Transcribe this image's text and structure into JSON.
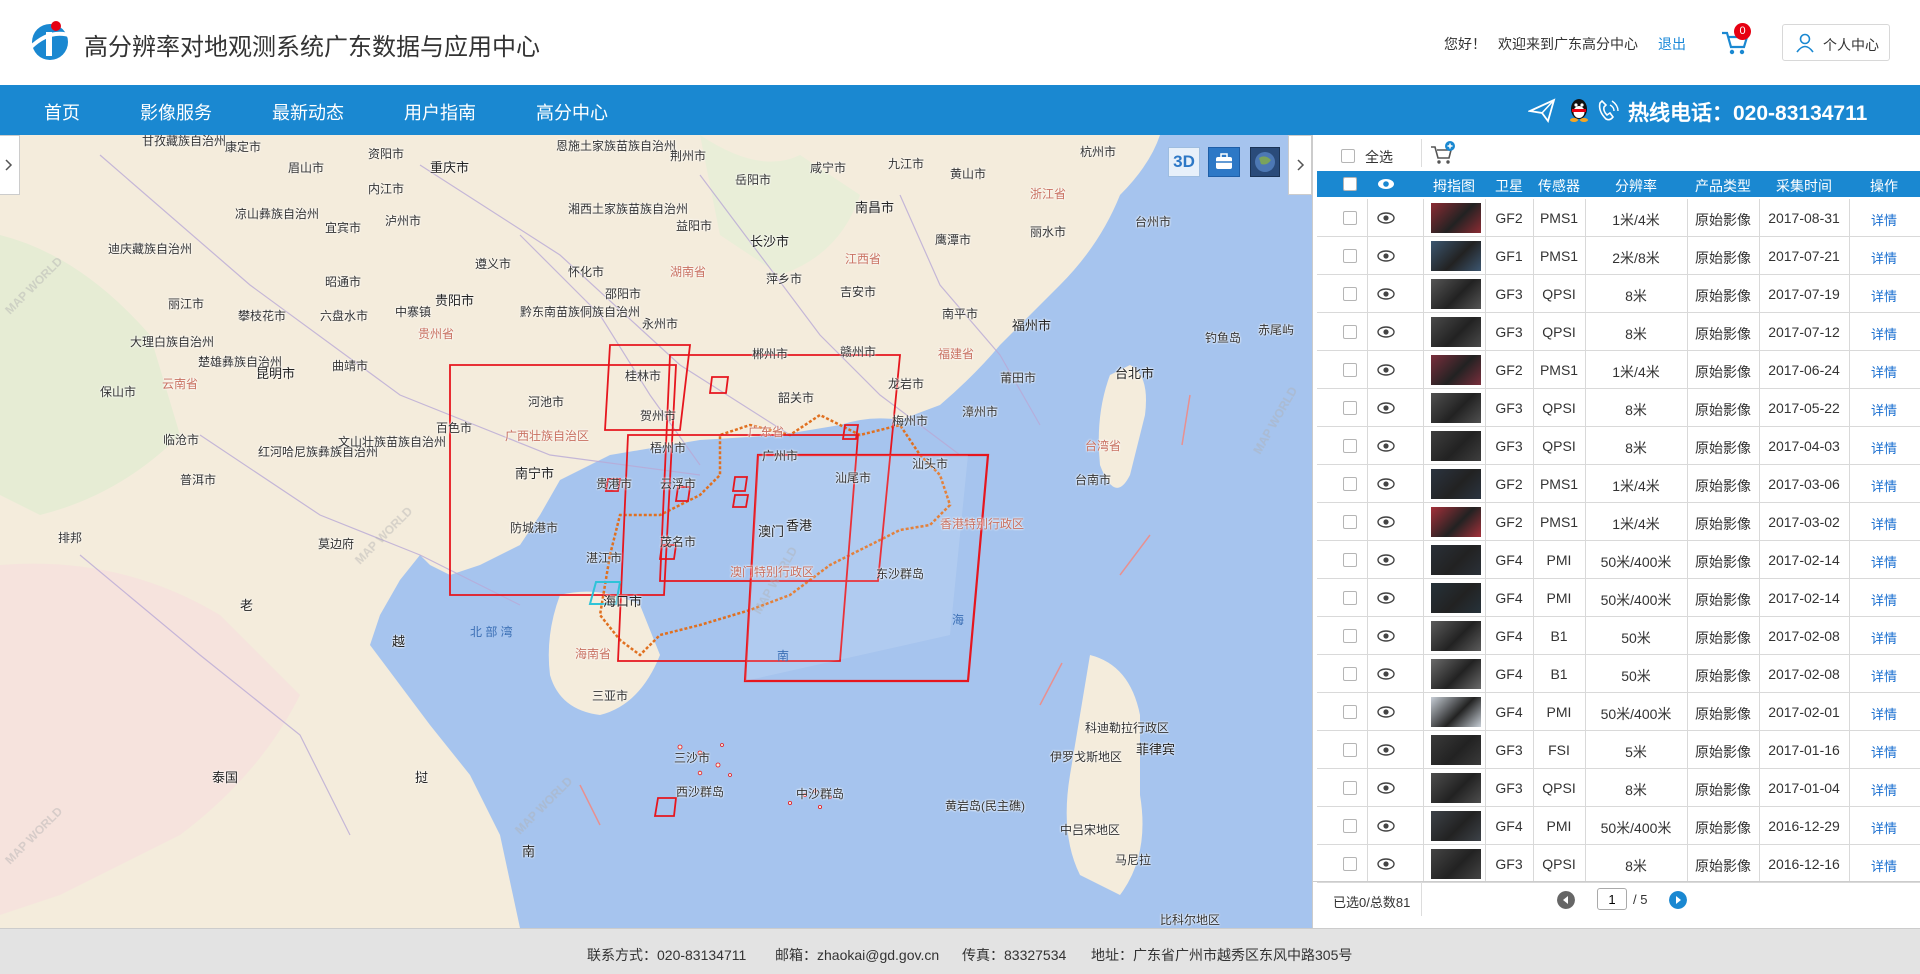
{
  "header": {
    "site_title": "高分辨率对地观测系统广东数据与应用中心",
    "greeting": "您好！",
    "welcome": "欢迎来到广东高分中心",
    "logout": "退出",
    "cart_count": "0",
    "user_center": "个人中心"
  },
  "nav": {
    "items": [
      "首页",
      "影像服务",
      "最新动态",
      "用户指南",
      "高分中心"
    ],
    "hotline": "热线电话：020-83134711"
  },
  "map": {
    "tool_3d": "3D",
    "labels": [
      {
        "t": "甘孜藏族自治州",
        "cls": ""
      },
      {
        "t": "康定市",
        "cls": ""
      },
      {
        "t": "眉山市",
        "cls": ""
      },
      {
        "t": "资阳市",
        "cls": ""
      },
      {
        "t": "重庆市",
        "cls": "big"
      },
      {
        "t": "恩施土家族苗族自治州",
        "cls": ""
      },
      {
        "t": "荆州市",
        "cls": ""
      },
      {
        "t": "咸宁市",
        "cls": ""
      },
      {
        "t": "九江市",
        "cls": ""
      },
      {
        "t": "黄山市",
        "cls": ""
      },
      {
        "t": "杭州市",
        "cls": ""
      },
      {
        "t": "内江市",
        "cls": ""
      },
      {
        "t": "岳阳市",
        "cls": ""
      },
      {
        "t": "南昌市",
        "cls": "big"
      },
      {
        "t": "浙江省",
        "cls": "prov"
      },
      {
        "t": "凉山彝族自治州",
        "cls": ""
      },
      {
        "t": "宜宾市",
        "cls": ""
      },
      {
        "t": "泸州市",
        "cls": ""
      },
      {
        "t": "湘西土家族苗族自治州",
        "cls": ""
      },
      {
        "t": "益阳市",
        "cls": ""
      },
      {
        "t": "长沙市",
        "cls": "big"
      },
      {
        "t": "鹰潭市",
        "cls": ""
      },
      {
        "t": "丽水市",
        "cls": ""
      },
      {
        "t": "台州市",
        "cls": ""
      },
      {
        "t": "迪庆藏族自治州",
        "cls": ""
      },
      {
        "t": "遵义市",
        "cls": ""
      },
      {
        "t": "怀化市",
        "cls": ""
      },
      {
        "t": "萍乡市",
        "cls": ""
      },
      {
        "t": "湖南省",
        "cls": "prov"
      },
      {
        "t": "江西省",
        "cls": "prov"
      },
      {
        "t": "昭通市",
        "cls": ""
      },
      {
        "t": "贵阳市",
        "cls": "big"
      },
      {
        "t": "邵阳市",
        "cls": ""
      },
      {
        "t": "吉安市",
        "cls": ""
      },
      {
        "t": "丽江市",
        "cls": ""
      },
      {
        "t": "攀枝花市",
        "cls": ""
      },
      {
        "t": "六盘水市",
        "cls": ""
      },
      {
        "t": "中寨镇",
        "cls": ""
      },
      {
        "t": "黔东南苗族侗族自治州",
        "cls": ""
      },
      {
        "t": "永州市",
        "cls": ""
      },
      {
        "t": "南平市",
        "cls": ""
      },
      {
        "t": "福州市",
        "cls": "big"
      },
      {
        "t": "钓鱼岛",
        "cls": ""
      },
      {
        "t": "赤尾屿",
        "cls": ""
      },
      {
        "t": "大理白族自治州",
        "cls": ""
      },
      {
        "t": "楚雄彝族自治州",
        "cls": ""
      },
      {
        "t": "昆明市",
        "cls": "big"
      },
      {
        "t": "曲靖市",
        "cls": ""
      },
      {
        "t": "贵州省",
        "cls": "prov"
      },
      {
        "t": "郴州市",
        "cls": ""
      },
      {
        "t": "赣州市",
        "cls": ""
      },
      {
        "t": "福建省",
        "cls": "prov"
      },
      {
        "t": "台北市",
        "cls": "big"
      },
      {
        "t": "保山市",
        "cls": ""
      },
      {
        "t": "云南省",
        "cls": "prov"
      },
      {
        "t": "桂林市",
        "cls": ""
      },
      {
        "t": "河池市",
        "cls": ""
      },
      {
        "t": "韶关市",
        "cls": ""
      },
      {
        "t": "龙岩市",
        "cls": ""
      },
      {
        "t": "莆田市",
        "cls": ""
      },
      {
        "t": "临沧市",
        "cls": ""
      },
      {
        "t": "百色市",
        "cls": ""
      },
      {
        "t": "贺州市",
        "cls": ""
      },
      {
        "t": "广西壮族自治区",
        "cls": "prov"
      },
      {
        "t": "广东省",
        "cls": "prov"
      },
      {
        "t": "梅州市",
        "cls": ""
      },
      {
        "t": "漳州市",
        "cls": ""
      },
      {
        "t": "红河哈尼族彝族自治州",
        "cls": ""
      },
      {
        "t": "文山壮族苗族自治州",
        "cls": ""
      },
      {
        "t": "梧州市",
        "cls": ""
      },
      {
        "t": "广州市",
        "cls": ""
      },
      {
        "t": "台湾省",
        "cls": "prov"
      },
      {
        "t": "普洱市",
        "cls": ""
      },
      {
        "t": "南宁市",
        "cls": "big"
      },
      {
        "t": "贵港市",
        "cls": ""
      },
      {
        "t": "云浮市",
        "cls": ""
      },
      {
        "t": "汕尾市",
        "cls": ""
      },
      {
        "t": "汕头市",
        "cls": ""
      },
      {
        "t": "台南市",
        "cls": ""
      },
      {
        "t": "防城港市",
        "cls": ""
      },
      {
        "t": "茂名市",
        "cls": ""
      },
      {
        "t": "澳门",
        "cls": "big"
      },
      {
        "t": "香港",
        "cls": "big"
      },
      {
        "t": "香港特别行政区",
        "cls": "prov"
      },
      {
        "t": "排邦",
        "cls": ""
      },
      {
        "t": "莫边府",
        "cls": ""
      },
      {
        "t": "湛江市",
        "cls": ""
      },
      {
        "t": "澳门特别行政区",
        "cls": "prov"
      },
      {
        "t": "东沙群岛",
        "cls": ""
      },
      {
        "t": "老",
        "cls": "big"
      },
      {
        "t": "海口市",
        "cls": "big"
      },
      {
        "t": "北 部 湾",
        "cls": "sea"
      },
      {
        "t": "越",
        "cls": "big"
      },
      {
        "t": "海",
        "cls": "sea"
      },
      {
        "t": "海南省",
        "cls": "prov"
      },
      {
        "t": "南",
        "cls": "sea"
      },
      {
        "t": "三亚市",
        "cls": ""
      },
      {
        "t": "科迪勒拉行政区",
        "cls": ""
      },
      {
        "t": "菲律宾",
        "cls": "big"
      },
      {
        "t": "三沙市",
        "cls": ""
      },
      {
        "t": "西沙群岛",
        "cls": ""
      },
      {
        "t": "中沙群岛",
        "cls": ""
      },
      {
        "t": "泰国",
        "cls": "big"
      },
      {
        "t": "挝",
        "cls": "big"
      },
      {
        "t": "伊罗戈斯地区",
        "cls": ""
      },
      {
        "t": "黄岩岛(民主礁)",
        "cls": ""
      },
      {
        "t": "中吕宋地区",
        "cls": ""
      },
      {
        "t": "马尼拉",
        "cls": ""
      },
      {
        "t": "南",
        "cls": "big"
      },
      {
        "t": "比科尔地区",
        "cls": ""
      }
    ]
  },
  "panel": {
    "select_all": "全选",
    "headers": [
      "拇指图",
      "卫星",
      "传感器",
      "分辨率",
      "产品类型",
      "采集时间",
      "操作"
    ],
    "rows": [
      {
        "sat": "GF2",
        "sensor": "PMS1",
        "res": "1米/4米",
        "type": "原始影像",
        "date": "2017-08-31",
        "op": "详情",
        "thumb": "#8c2b33"
      },
      {
        "sat": "GF1",
        "sensor": "PMS1",
        "res": "2米/8米",
        "type": "原始影像",
        "date": "2017-07-21",
        "op": "详情",
        "thumb": "#3c5670"
      },
      {
        "sat": "GF3",
        "sensor": "QPSI",
        "res": "8米",
        "type": "原始影像",
        "date": "2017-07-19",
        "op": "详情",
        "thumb": "#555555"
      },
      {
        "sat": "GF3",
        "sensor": "QPSI",
        "res": "8米",
        "type": "原始影像",
        "date": "2017-07-12",
        "op": "详情",
        "thumb": "#4a4a4a"
      },
      {
        "sat": "GF2",
        "sensor": "PMS1",
        "res": "1米/4米",
        "type": "原始影像",
        "date": "2017-06-24",
        "op": "详情",
        "thumb": "#7a2e3c"
      },
      {
        "sat": "GF3",
        "sensor": "QPSI",
        "res": "8米",
        "type": "原始影像",
        "date": "2017-05-22",
        "op": "详情",
        "thumb": "#505050"
      },
      {
        "sat": "GF3",
        "sensor": "QPSI",
        "res": "8米",
        "type": "原始影像",
        "date": "2017-04-03",
        "op": "详情",
        "thumb": "#3e3e3e"
      },
      {
        "sat": "GF2",
        "sensor": "PMS1",
        "res": "1米/4米",
        "type": "原始影像",
        "date": "2017-03-06",
        "op": "详情",
        "thumb": "#2b3440"
      },
      {
        "sat": "GF2",
        "sensor": "PMS1",
        "res": "1米/4米",
        "type": "原始影像",
        "date": "2017-03-02",
        "op": "详情",
        "thumb": "#a5303a"
      },
      {
        "sat": "GF4",
        "sensor": "PMI",
        "res": "50米/400米",
        "type": "原始影像",
        "date": "2017-02-14",
        "op": "详情",
        "thumb": "#2a3038"
      },
      {
        "sat": "GF4",
        "sensor": "PMI",
        "res": "50米/400米",
        "type": "原始影像",
        "date": "2017-02-14",
        "op": "详情",
        "thumb": "#26323a"
      },
      {
        "sat": "GF4",
        "sensor": "B1",
        "res": "50米",
        "type": "原始影像",
        "date": "2017-02-08",
        "op": "详情",
        "thumb": "#5c5c5c"
      },
      {
        "sat": "GF4",
        "sensor": "B1",
        "res": "50米",
        "type": "原始影像",
        "date": "2017-02-08",
        "op": "详情",
        "thumb": "#6a6a6a"
      },
      {
        "sat": "GF4",
        "sensor": "PMI",
        "res": "50米/400米",
        "type": "原始影像",
        "date": "2017-02-01",
        "op": "详情",
        "thumb": "#c7ced6"
      },
      {
        "sat": "GF3",
        "sensor": "FSI",
        "res": "5米",
        "type": "原始影像",
        "date": "2017-01-16",
        "op": "详情",
        "thumb": "#3a3a3a"
      },
      {
        "sat": "GF3",
        "sensor": "QPSI",
        "res": "8米",
        "type": "原始影像",
        "date": "2017-01-04",
        "op": "详情",
        "thumb": "#4d4d4d"
      },
      {
        "sat": "GF4",
        "sensor": "PMI",
        "res": "50米/400米",
        "type": "原始影像",
        "date": "2016-12-29",
        "op": "详情",
        "thumb": "#3d4248"
      },
      {
        "sat": "GF3",
        "sensor": "QPSI",
        "res": "8米",
        "type": "原始影像",
        "date": "2016-12-16",
        "op": "详情",
        "thumb": "#444444"
      }
    ],
    "selected_count": "已选0/总数81",
    "page": "1",
    "page_total": "/ 5"
  },
  "footer": {
    "contact": "联系方式：020-83134711",
    "email": "邮箱：zhaokai@gd.gov.cn",
    "fax": "传真：83327534",
    "address": "地址：广东省广州市越秀区东风中路305号"
  }
}
